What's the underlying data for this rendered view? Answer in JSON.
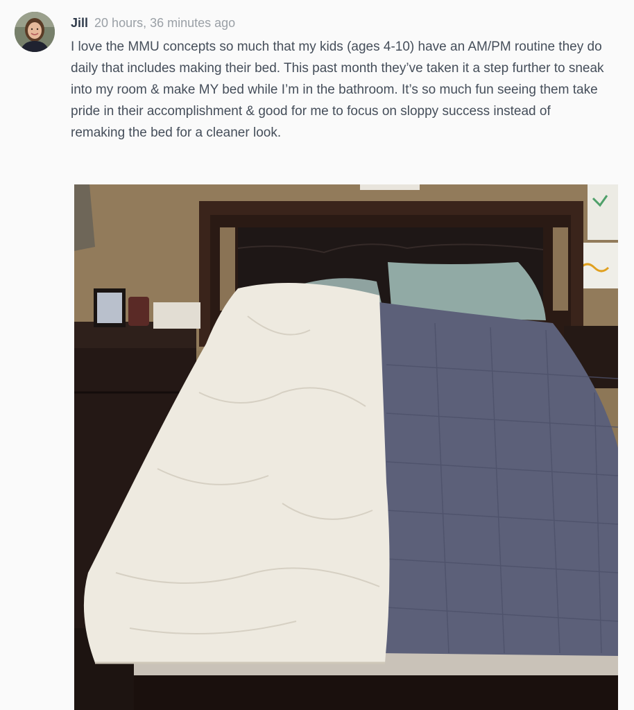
{
  "post": {
    "author": "Jill",
    "timestamp": "20 hours, 36 minutes ago",
    "body": "I love the MMU concepts so much that my kids (ages 4-10) have an AM/PM routine they do daily that includes making their bed. This past month they’ve taken it a step further to sneak into my room & make MY bed while I’m in the bathroom. It’s so much fun seeing them take pride in their accomplishment & good for me to focus on sloppy success instead of remaking the bed for a cleaner look."
  },
  "avatar_icon": "user-avatar-photo",
  "colors": {
    "author": "#2f3a4a",
    "timestamp": "#9aa0a6",
    "body_text": "#454e5a",
    "background": "#fafafa"
  }
}
